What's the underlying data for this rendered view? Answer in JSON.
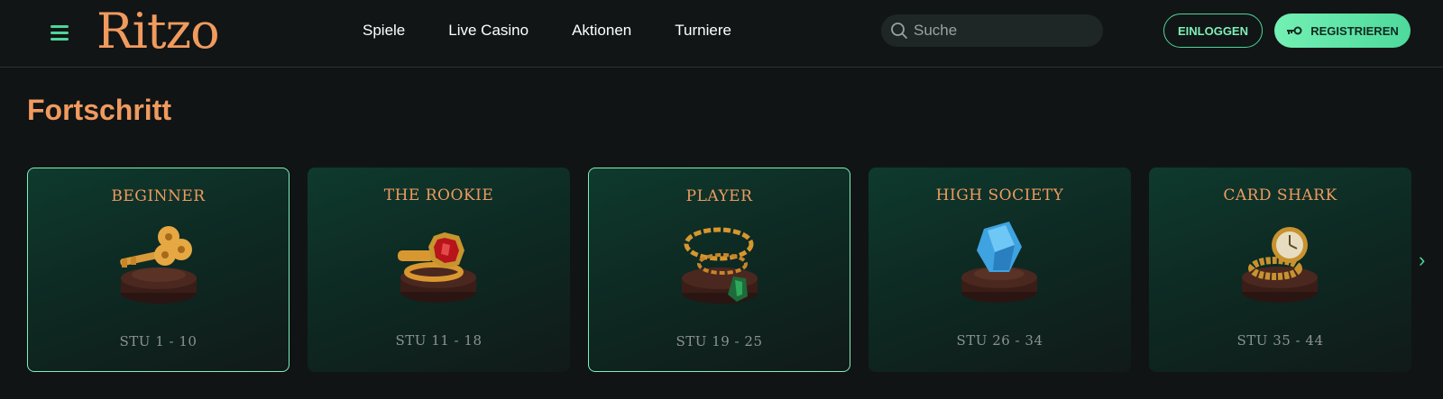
{
  "header": {
    "logo": "Ritzo",
    "nav": [
      "Spiele",
      "Live Casino",
      "Aktionen",
      "Turniere"
    ],
    "search_placeholder": "Suche",
    "login_label": "EINLOGGEN",
    "register_label": "REGISTRIEREN"
  },
  "section": {
    "title": "Fortschritt"
  },
  "cards": [
    {
      "title": "BEGINNER",
      "level": "STU 1 - 10",
      "icon": "key-icon"
    },
    {
      "title": "THE ROOKIE",
      "level": "STU 11 - 18",
      "icon": "ruby-ring-icon"
    },
    {
      "title": "PLAYER",
      "level": "STU 19 - 25",
      "icon": "chain-necklace-icon"
    },
    {
      "title": "HIGH SOCIETY",
      "level": "STU 26 - 34",
      "icon": "diamond-icon"
    },
    {
      "title": "CARD SHARK",
      "level": "STU 35 - 44",
      "icon": "watch-icon"
    }
  ],
  "colors": {
    "accent": "#4fd59a",
    "brand": "#f09a5e",
    "background": "#101415"
  }
}
